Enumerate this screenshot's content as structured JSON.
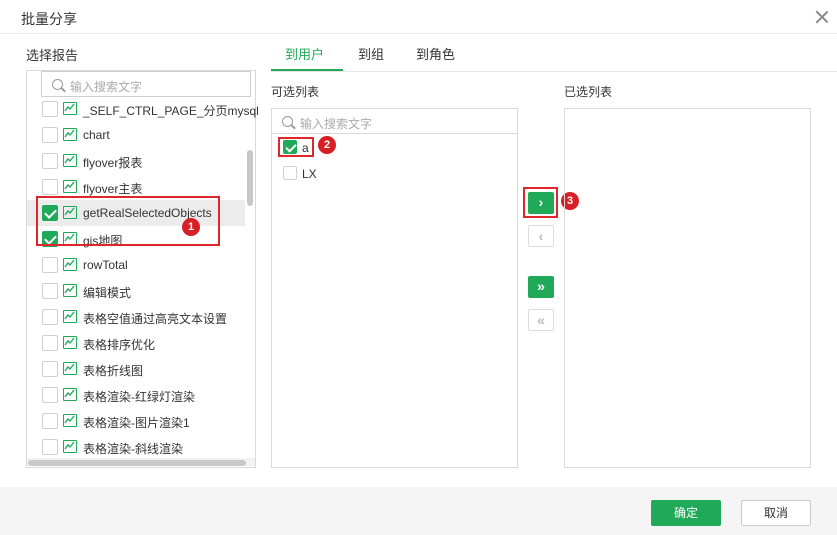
{
  "dialog": {
    "title": "批量分享"
  },
  "left": {
    "label": "选择报告",
    "search_placeholder": "输入搜索文字",
    "items": [
      {
        "label": "_SELF_CTRL_PAGE_分页mysql",
        "checked": false
      },
      {
        "label": "chart",
        "checked": false
      },
      {
        "label": "flyover报表",
        "checked": false
      },
      {
        "label": "flyover主表",
        "checked": false
      },
      {
        "label": "getRealSelectedObjects",
        "checked": true
      },
      {
        "label": "gis地图",
        "checked": true
      },
      {
        "label": "rowTotal",
        "checked": false
      },
      {
        "label": "编辑模式",
        "checked": false
      },
      {
        "label": "表格空值通过高亮文本设置",
        "checked": false
      },
      {
        "label": "表格排序优化",
        "checked": false
      },
      {
        "label": "表格折线图",
        "checked": false
      },
      {
        "label": "表格渲染-红绿灯渲染",
        "checked": false
      },
      {
        "label": "表格渲染-图片渲染1",
        "checked": false
      },
      {
        "label": "表格渲染-斜线渲染",
        "checked": false
      }
    ]
  },
  "tabs": [
    {
      "label": "到用户",
      "active": true
    },
    {
      "label": "到组",
      "active": false
    },
    {
      "label": "到角色",
      "active": false
    }
  ],
  "available": {
    "label": "可选列表",
    "search_placeholder": "输入搜索文字",
    "items": [
      {
        "label": "a",
        "checked": true
      },
      {
        "label": "LX",
        "checked": false
      }
    ]
  },
  "selected": {
    "label": "已选列表"
  },
  "transfer": {
    "add": "›",
    "remove": "‹",
    "add_all": "»",
    "remove_all": "«"
  },
  "badges": [
    "1",
    "2",
    "3"
  ],
  "footer": {
    "ok": "确定",
    "cancel": "取消"
  },
  "colors": {
    "accent": "#21a95a",
    "annotation": "#e0262b"
  }
}
